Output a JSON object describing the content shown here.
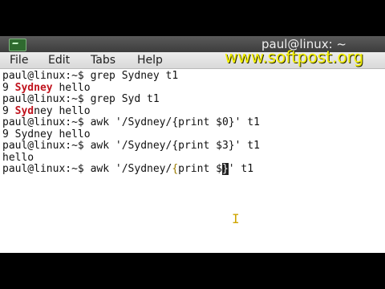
{
  "window": {
    "title": "paul@linux: ~"
  },
  "menu": {
    "file": "File",
    "edit": "Edit",
    "tabs": "Tabs",
    "help": "Help"
  },
  "watermark": "www.softpost.org",
  "terminal": {
    "prompt": "paul@linux:~$ ",
    "lines": {
      "l1": {
        "cmd": "grep Sydney t1"
      },
      "l2": {
        "pre": "9 ",
        "match": "Sydney",
        "post": " hello"
      },
      "l3": {
        "cmd": "grep Syd t1"
      },
      "l4": {
        "pre": "9 ",
        "match": "Syd",
        "post": "ney hello"
      },
      "l5": {
        "cmd": "awk '/Sydney/{print $0}' t1"
      },
      "l6": {
        "text": "9 Sydney hello"
      },
      "l7": {
        "cmd": "awk '/Sydney/{print $3}' t1"
      },
      "l8": {
        "text": "hello"
      },
      "l9": {
        "cmd_a": "awk '/Sydney/",
        "brace": "{",
        "cmd_b": "print $",
        "cursor_char": "}",
        "cmd_c": "' t1"
      }
    }
  },
  "icons": {
    "app": "terminal-app-icon",
    "mouse": "text-ibeam-cursor-icon"
  },
  "colors": {
    "match": "#c0141e",
    "watermark": "#f6f200",
    "brace_highlight": "#9a7a00"
  }
}
